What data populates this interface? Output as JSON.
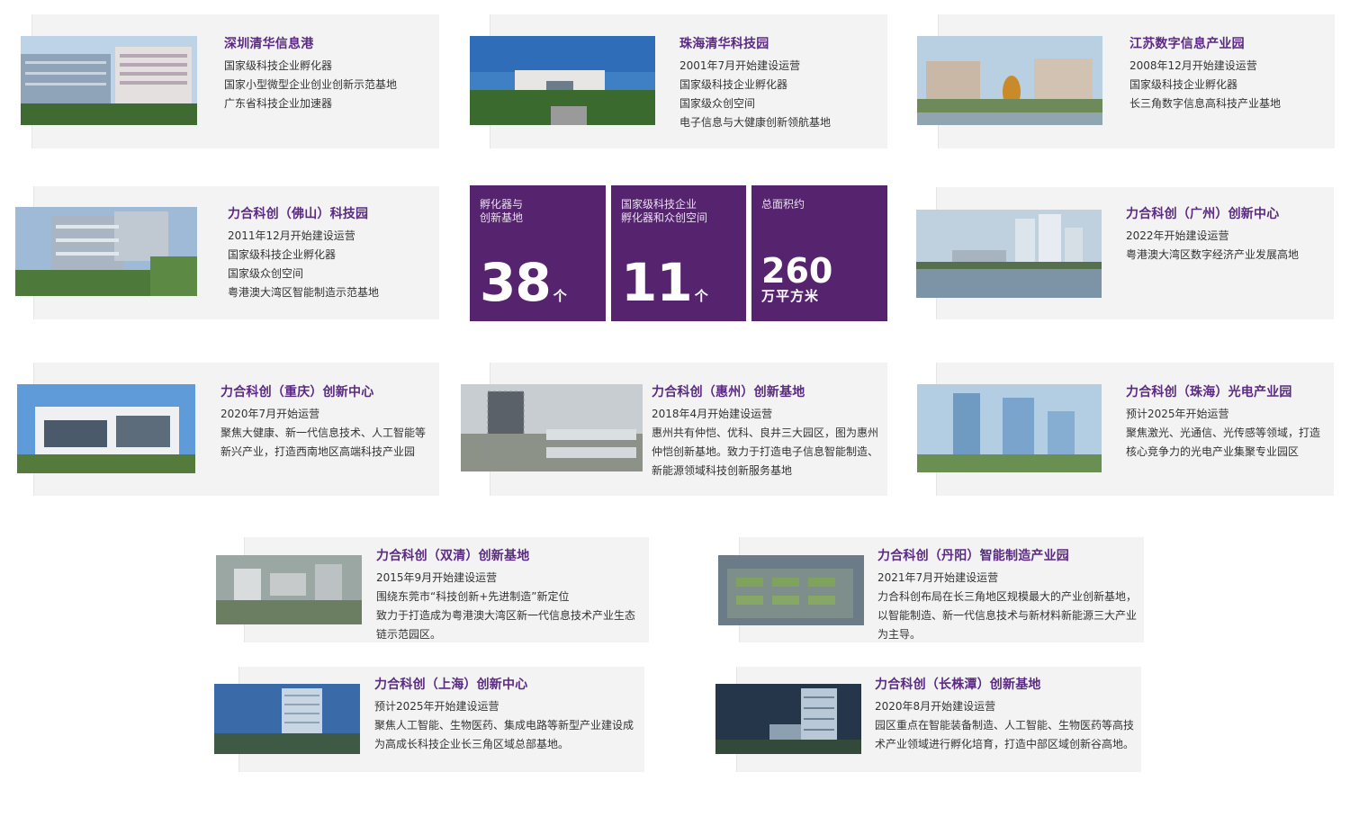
{
  "parks": [
    {
      "title": "深圳清华信息港",
      "lines": [
        "国家级科技企业孵化器",
        "国家小型微型企业创业创新示范基地",
        "广东省科技企业加速器"
      ]
    },
    {
      "title": "珠海清华科技园",
      "lines": [
        "2001年7月开始建设运营",
        "国家级科技企业孵化器",
        "国家级众创空间",
        "电子信息与大健康创新领航基地"
      ]
    },
    {
      "title": "江苏数字信息产业园",
      "lines": [
        "2008年12月开始建设运营",
        "国家级科技企业孵化器",
        "长三角数字信息高科技产业基地"
      ]
    },
    {
      "title": "力合科创（佛山）科技园",
      "lines": [
        "2011年12月开始建设运营",
        "国家级科技企业孵化器",
        "国家级众创空间",
        "粤港澳大湾区智能制造示范基地"
      ]
    },
    {
      "title": "力合科创（广州）创新中心",
      "lines": [
        "2022年开始建设运营",
        "粤港澳大湾区数字经济产业发展高地"
      ]
    },
    {
      "title": "力合科创（重庆）创新中心",
      "lines": [
        "2020年7月开始运营",
        "聚焦大健康、新一代信息技术、人工智能等新兴产业，打造西南地区高端科技产业园"
      ]
    },
    {
      "title": "力合科创（惠州）创新基地",
      "lines": [
        "2018年4月开始建设运营",
        "惠州共有仲恺、优科、良井三大园区，图为惠州仲恺创新基地。致力于打造电子信息智能制造、新能源领域科技创新服务基地"
      ]
    },
    {
      "title": "力合科创（珠海）光电产业园",
      "lines": [
        "预计2025年开始运营",
        "聚焦激光、光通信、光传感等领域，打造核心竞争力的光电产业集聚专业园区"
      ]
    },
    {
      "title": "力合科创（双清）创新基地",
      "lines": [
        "2015年9月开始建设运营",
        "围绕东莞市“科技创新+先进制造”新定位",
        "致力于打造成为粤港澳大湾区新一代信息技术产业生态链示范园区。"
      ]
    },
    {
      "title": "力合科创（丹阳）智能制造产业园",
      "lines": [
        "2021年7月开始建设运营",
        "力合科创布局在长三角地区规模最大的产业创新基地，以智能制造、新一代信息技术与新材料新能源三大产业为主导。"
      ]
    },
    {
      "title": "力合科创（上海）创新中心",
      "lines": [
        "预计2025年开始建设运营",
        "聚焦人工智能、生物医药、集成电路等新型产业建设成为高成长科技企业长三角区域总部基地。"
      ]
    },
    {
      "title": "力合科创（长株潭）创新基地",
      "lines": [
        "2020年8月开始建设运营",
        "园区重点在智能装备制造、人工智能、生物医药等高技术产业领域进行孵化培育，打造中部区域创新谷高地。"
      ]
    }
  ],
  "stats": [
    {
      "label": "孵化器与\n创新基地",
      "value": "38",
      "unit": "个"
    },
    {
      "label": "国家级科技企业\n孵化器和众创空间",
      "value": "11",
      "unit": "个"
    },
    {
      "label": "总面积约",
      "value": "260",
      "unit": "万平方米"
    }
  ],
  "colors": {
    "accent": "#5b2a82",
    "stat_bg": "#56246f",
    "card_bg": "#f3f3f4"
  }
}
